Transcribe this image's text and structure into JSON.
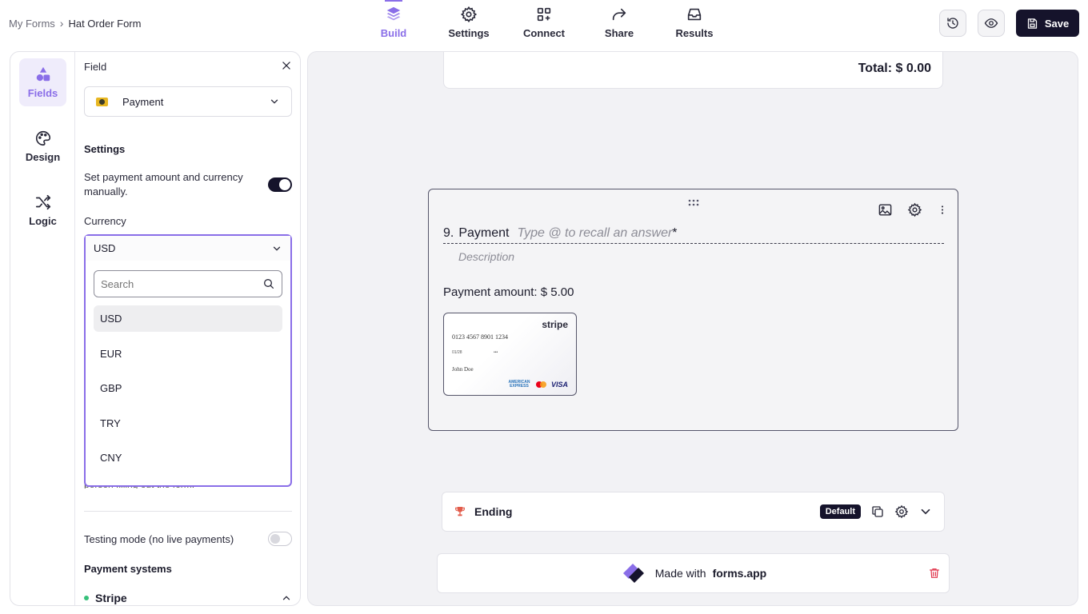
{
  "breadcrumb": {
    "root": "My Forms",
    "separator": "›",
    "current": "Hat Order Form"
  },
  "topnav": {
    "tabs": [
      {
        "label": "Build",
        "icon": "layers-icon",
        "active": true
      },
      {
        "label": "Settings",
        "icon": "gear-icon",
        "active": false
      },
      {
        "label": "Connect",
        "icon": "apps-add-icon",
        "active": false
      },
      {
        "label": "Share",
        "icon": "share-arrow-icon",
        "active": false
      },
      {
        "label": "Results",
        "icon": "inbox-icon",
        "active": false
      }
    ]
  },
  "actions": {
    "history_icon": "history-icon",
    "preview_icon": "eye-icon",
    "save_label": "Save"
  },
  "siderail": {
    "items": [
      {
        "label": "Fields",
        "icon": "shapes-icon",
        "active": true
      },
      {
        "label": "Design",
        "icon": "palette-icon",
        "active": false
      },
      {
        "label": "Logic",
        "icon": "shuffle-icon",
        "active": false
      }
    ]
  },
  "panel": {
    "field_label": "Field",
    "field_type": "Payment",
    "settings_title": "Settings",
    "manual_setting": "Set payment amount and currency manually.",
    "manual_on": true,
    "currency_label": "Currency",
    "currency_value": "USD",
    "search_placeholder": "Search",
    "currency_options": [
      "USD",
      "EUR",
      "GBP",
      "TRY",
      "CNY"
    ],
    "hidden_hint": "person filling out the form.",
    "testing_label": "Testing mode (no live payments)",
    "testing_on": false,
    "payment_systems_title": "Payment systems",
    "payment_system": "Stripe"
  },
  "canvas": {
    "total_text": "Total: $ 0.00",
    "question": {
      "number": "9.",
      "title": "Payment",
      "placeholder": "Type @ to recall an answer",
      "required_mark": "*",
      "description_placeholder": "Description",
      "amount_text": "Payment amount: $ 5.00"
    },
    "card_preview": {
      "brand": "stripe",
      "number": "0123 4567 8901 1234",
      "expiry": "01/28",
      "cvc": "•••",
      "name": "John Doe",
      "networks": [
        "AMERICAN EXPRESS",
        "VISA"
      ]
    },
    "ending": {
      "label": "Ending",
      "badge": "Default"
    },
    "branding": {
      "prefix": "Made with",
      "brand": "forms.app"
    }
  },
  "colors": {
    "accent": "#8a6ee8",
    "dark": "#15132b",
    "canvas_bg": "#f2f2f5",
    "trash": "#e0334a"
  }
}
